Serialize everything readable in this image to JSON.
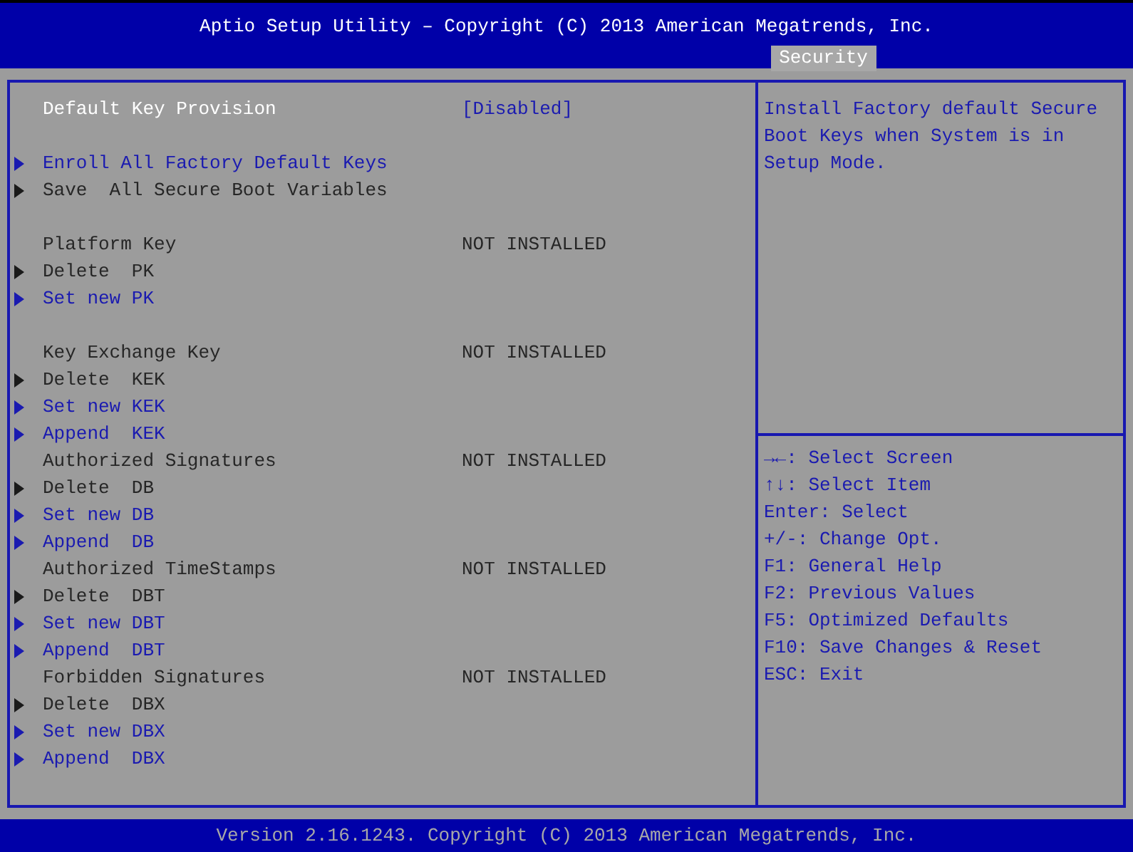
{
  "header": {
    "title": "Aptio Setup Utility – Copyright (C) 2013 American Megatrends, Inc.",
    "tabs": [
      {
        "label": "Security",
        "selected": true
      }
    ]
  },
  "sections": [
    {
      "items": [
        {
          "kind": "setting",
          "label": "Default Key Provision",
          "value": "[Disabled]",
          "selected": true
        }
      ]
    },
    {
      "items": [
        {
          "kind": "submenu",
          "label": "Enroll All Factory Default Keys",
          "enabled": true,
          "selected": false
        },
        {
          "kind": "submenu",
          "label": "Save  All Secure Boot Variables",
          "enabled": false,
          "selected": false
        }
      ]
    },
    {
      "items": [
        {
          "kind": "info",
          "label": "Platform Key",
          "value": "NOT INSTALLED",
          "selected": false
        },
        {
          "kind": "submenu",
          "label": "Delete  PK",
          "enabled": false,
          "selected": false
        },
        {
          "kind": "submenu",
          "label": "Set new PK",
          "enabled": true,
          "selected": false
        }
      ]
    },
    {
      "items": [
        {
          "kind": "info",
          "label": "Key Exchange Key",
          "value": "NOT INSTALLED",
          "selected": false
        },
        {
          "kind": "submenu",
          "label": "Delete  KEK",
          "enabled": false,
          "selected": false
        },
        {
          "kind": "submenu",
          "label": "Set new KEK",
          "enabled": true,
          "selected": false
        },
        {
          "kind": "submenu",
          "label": "Append  KEK",
          "enabled": true,
          "selected": false
        },
        {
          "kind": "info",
          "label": "Authorized Signatures",
          "value": "NOT INSTALLED",
          "selected": false
        },
        {
          "kind": "submenu",
          "label": "Delete  DB",
          "enabled": false,
          "selected": false
        },
        {
          "kind": "submenu",
          "label": "Set new DB",
          "enabled": true,
          "selected": false
        },
        {
          "kind": "submenu",
          "label": "Append  DB",
          "enabled": true,
          "selected": false
        },
        {
          "kind": "info",
          "label": "Authorized TimeStamps",
          "value": "NOT INSTALLED",
          "selected": false
        },
        {
          "kind": "submenu",
          "label": "Delete  DBT",
          "enabled": false,
          "selected": false
        },
        {
          "kind": "submenu",
          "label": "Set new DBT",
          "enabled": true,
          "selected": false
        },
        {
          "kind": "submenu",
          "label": "Append  DBT",
          "enabled": true,
          "selected": false
        },
        {
          "kind": "info",
          "label": "Forbidden Signatures",
          "value": "NOT INSTALLED",
          "selected": false
        },
        {
          "kind": "submenu",
          "label": "Delete  DBX",
          "enabled": false,
          "selected": false
        },
        {
          "kind": "submenu",
          "label": "Set new DBX",
          "enabled": true,
          "selected": false
        },
        {
          "kind": "submenu",
          "label": "Append  DBX",
          "enabled": true,
          "selected": false
        }
      ]
    }
  ],
  "help": "Install Factory default Secure Boot Keys when System is in Setup Mode.",
  "key_legend": [
    {
      "key": "→←:",
      "action": "Select Screen"
    },
    {
      "key": "↑↓:",
      "action": "Select Item"
    },
    {
      "key": "Enter:",
      "action": "Select"
    },
    {
      "key": "+/-:",
      "action": "Change Opt."
    },
    {
      "key": "F1:",
      "action": "General Help"
    },
    {
      "key": "F2:",
      "action": "Previous Values"
    },
    {
      "key": "F5:",
      "action": "Optimized Defaults"
    },
    {
      "key": "F10:",
      "action": "Save Changes & Reset"
    },
    {
      "key": "ESC:",
      "action": "Exit"
    }
  ],
  "footer": "Version 2.16.1243. Copyright (C) 2013 American Megatrends, Inc."
}
